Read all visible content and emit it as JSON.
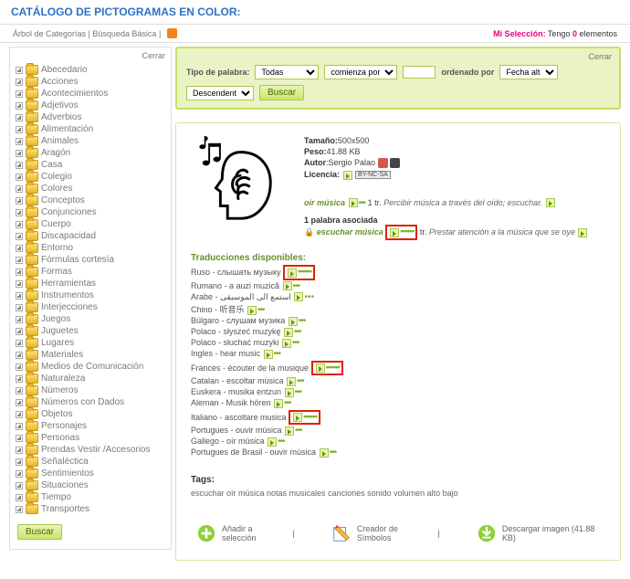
{
  "title": "CATÁLOGO DE PICTOGRAMAS EN COLOR:",
  "toolbar": {
    "tree_link": "Árbol de Categorías",
    "basic_search_link": "Búsqueda Básica",
    "close": "Cerrar",
    "my_selection_label": "Mi Selección:",
    "my_selection_text_pre": "Tengo ",
    "my_selection_count": "0",
    "my_selection_text_post": " elementos"
  },
  "sidebar": {
    "categories": [
      "Abecedario",
      "Acciones",
      "Acontecimientos",
      "Adjetivos",
      "Adverbios",
      "Alimentación",
      "Animales",
      "Aragón",
      "Casa",
      "Colegio",
      "Colores",
      "Conceptos",
      "Conjunciones",
      "Cuerpo",
      "Discapacidad",
      "Entorno",
      "Fórmulas cortesía",
      "Formas",
      "Herramientas",
      "Instrumentos",
      "Interjecciones",
      "Juegos",
      "Juguetes",
      "Lugares",
      "Materiales",
      "Medios de Comunicación",
      "Naturaleza",
      "Números",
      "Números con Dados",
      "Objetos",
      "Personajes",
      "Personas",
      "Prendas Vestir /Accesorios",
      "Señaléctica",
      "Sentimientos",
      "Situaciones",
      "Tiempo",
      "Transportes"
    ],
    "search_button": "Buscar"
  },
  "search": {
    "word_type_label": "Tipo de palabra:",
    "word_type_value": "Todas",
    "match_value": "comienza por",
    "query_value": "",
    "order_label": "ordenado por",
    "order_field_value": "Fecha alta",
    "order_dir_value": "Descendente",
    "button": "Buscar",
    "close": "Cerrar"
  },
  "detail": {
    "size_label": "Tamaño:",
    "size_value": "500x500",
    "weight_label": "Peso:",
    "weight_value": "41.88 KB",
    "author_label": "Autor",
    "author_value": "Sergio Palao",
    "license_label": "Licencia:",
    "license_badge": "BY-NC-SA",
    "term": "oír música",
    "pos": "tr.",
    "definition": "Percibir música a través del oído; escuchar.",
    "assoc_header": "1 palabra asociada",
    "assoc_term": "escuchar música",
    "assoc_pos": "tr.",
    "assoc_def": "Prestar atención a la música que se oye"
  },
  "translations": {
    "header": "Traducciones disponibles:",
    "items": [
      {
        "text": "Ruso - слышать музыку",
        "hl": true
      },
      {
        "text": "Rumano - a auzi muzică",
        "hl": false
      },
      {
        "text": "Arabe - استمع الى الموسيقى",
        "hl": false
      },
      {
        "text": "Chino - 听音乐",
        "hl": false
      },
      {
        "text": "Búlgaro - слушам музика",
        "hl": false
      },
      {
        "text": "Polaco - słyszeć muzykę",
        "hl": false
      },
      {
        "text": "Polaco - słuchać muzyki",
        "hl": false
      },
      {
        "text": "Ingles - hear music",
        "hl": false
      },
      {
        "text": "Frances - écouter de la musique",
        "hl": true
      },
      {
        "text": "Catalan - escoltar música",
        "hl": false
      },
      {
        "text": "Euskera - musika entzun",
        "hl": false
      },
      {
        "text": "Aleman - Musik hören",
        "hl": false
      },
      {
        "text": "Italiano - ascoltare musica",
        "hl": true
      },
      {
        "text": "Portugues - ouvir música",
        "hl": false
      },
      {
        "text": "Gallego - oír música",
        "hl": false
      },
      {
        "text": "Portugues de Brasil - ouvir música",
        "hl": false
      }
    ]
  },
  "tags": {
    "header": "Tags:",
    "text": "escuchar oír música notas musicales canciones sonido volumen alto bajo"
  },
  "actions": {
    "add": "Añadir a selección",
    "creator": "Creador de Símbolos",
    "download": "Descargar imagen (41.88 KB)"
  }
}
